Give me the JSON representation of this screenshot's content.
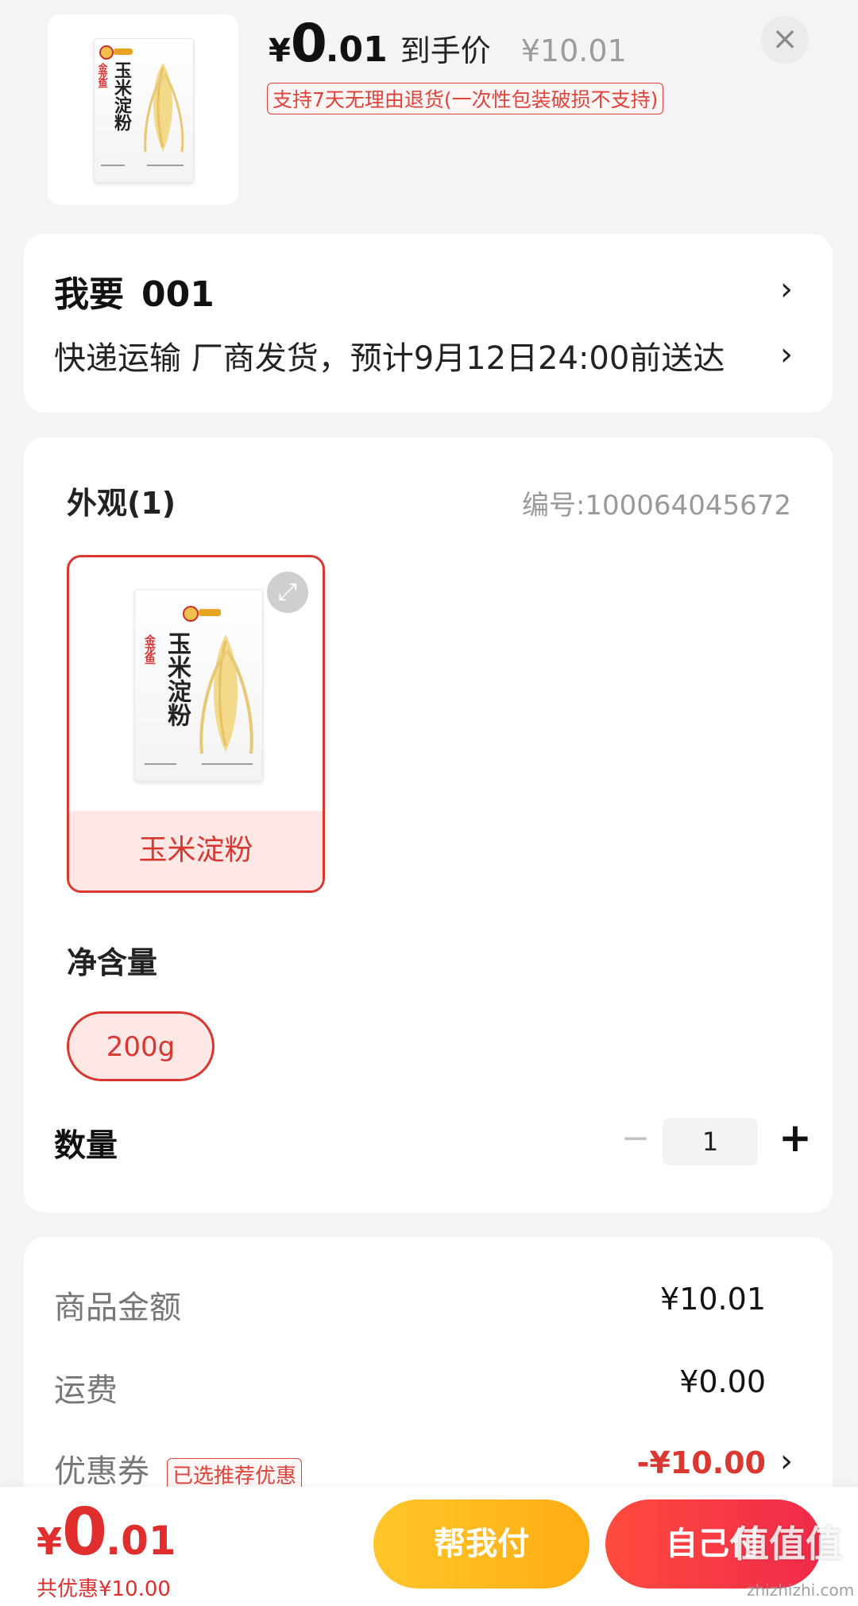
{
  "header": {
    "currency": "¥",
    "price_int": "0",
    "price_dec": ".01",
    "final_price_label": "到手价",
    "original_price": "¥10.01",
    "return_policy": "支持7天无理由退货(一次性包装破损不支持)",
    "close_icon": "×"
  },
  "product_image": {
    "brand": "金龙鱼",
    "product_name": "玉米淀粉"
  },
  "delivery": {
    "want_label": "我要",
    "want_quantity": "001",
    "shipping_text": "快递运输 厂商发货，预计9月12日24:00前送达"
  },
  "spec": {
    "appearance_title": "外观(1)",
    "sku": "编号:100064045672",
    "variant_label": "玉米淀粉",
    "net_weight_title": "净含量",
    "net_weight_option": "200g",
    "quantity_title": "数量",
    "quantity_value": "1",
    "minus_symbol": "−",
    "plus_symbol": "+"
  },
  "fees": {
    "goods_label": "商品金额",
    "goods_value": "¥10.01",
    "shipping_label": "运费",
    "shipping_value": "¥0.00",
    "coupon_label": "优惠券",
    "coupon_tag": "已选推荐优惠",
    "coupon_value": "-¥10.00"
  },
  "footer": {
    "currency": "¥",
    "price_int": "0",
    "price_dec": ".01",
    "saving_text": "共优惠¥10.00",
    "help_pay_label": "帮我付",
    "self_pay_label": "自己付"
  },
  "watermark": {
    "text": "值值值",
    "sub": "zhizhizhi.com"
  },
  "colors": {
    "accent_red": "#d9372f",
    "pay_yellow": "#ffb81c",
    "pay_red": "#f0304a"
  },
  "icons": {
    "close": "close-icon",
    "chevron": "chevron-right-icon",
    "expand": "expand-icon",
    "minus": "minus-icon",
    "plus": "plus-icon"
  }
}
